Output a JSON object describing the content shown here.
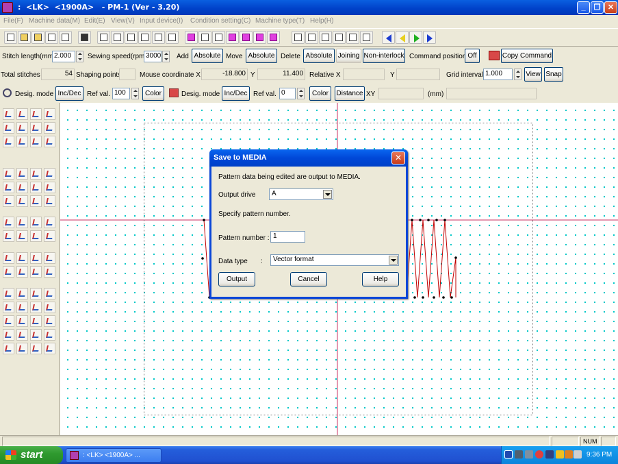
{
  "window": {
    "title": ":  <LK>  <1900A>   - PM-1 (Ver - 3.20)",
    "minimize": "_",
    "restore": "❐",
    "close": "✕"
  },
  "menu": [
    "File(F)",
    "Machine data(M)",
    "Edit(E)",
    "View(V)",
    "Input device(I)",
    "Condition setting(C)",
    "Machine type(T)",
    "Help(H)"
  ],
  "row1": {
    "stitch_length_label": "Stitch length(mm)",
    "stitch_length_value": "2.000",
    "sewing_speed_label": "Sewing speed(rpm)",
    "sewing_speed_value": "3000",
    "add_label": "Add",
    "add_button": "Absolute",
    "move_label": "Move",
    "move_button": "Absolute",
    "delete_label": "Delete",
    "delete_button": "Absolute",
    "joining_button": "Joining",
    "noninterlock_button": "Non-interlock",
    "command_position_label": "Command position",
    "command_position_button": "Off",
    "copy_command_button": "Copy Command"
  },
  "row2": {
    "total_stitches_label": "Total stitches",
    "total_stitches_value": "54",
    "shaping_points_label": "Shaping points",
    "mouse_coord_label": "Mouse coordinate X",
    "mouse_x": "-18.800",
    "y_label": "Y",
    "mouse_y": "11.400",
    "relative_label": "Relative X",
    "relative_y_label": "Y",
    "grid_interval_label": "Grid interval",
    "grid_interval_value": "1.000",
    "view_button": "View",
    "snap_button": "Snap"
  },
  "row3": {
    "desig_mode_label": "Desig. mode",
    "incdec_button": "Inc/Dec",
    "ref_val_label": "Ref val.",
    "ref_val_value": "100",
    "color_button": "Color",
    "desig_mode_label2": "Desig. mode",
    "incdec_button2": "Inc/Dec",
    "ref_val_label2": "Ref val.",
    "ref_val_value2": "0",
    "color_button2": "Color",
    "distance_button": "Distance",
    "xy_label": "XY",
    "mm_label": "(mm)"
  },
  "dialog": {
    "title": "Save to MEDIA",
    "message": "Pattern data being edited are output to MEDIA.",
    "output_drive_label": "Output drive",
    "output_drive_value": "A",
    "specify_label": "Specify pattern number.",
    "pattern_number_label": "Pattern number :",
    "pattern_number_value": "1",
    "data_type_label": "Data type",
    "data_type_colon": ":",
    "data_type_value": "Vector format",
    "output_button": "Output",
    "cancel_button": "Cancel",
    "help_button": "Help"
  },
  "statusbar": {
    "num": "NUM"
  },
  "taskbar": {
    "start": "start",
    "task": ":  <LK>  <1900A>  ...",
    "clock": "9:36 PM"
  },
  "colors": {
    "grid_dot": "#00c8c8",
    "axis": "#c83060",
    "stitch": "#c00000",
    "titlebar": "#0a5fe0"
  }
}
